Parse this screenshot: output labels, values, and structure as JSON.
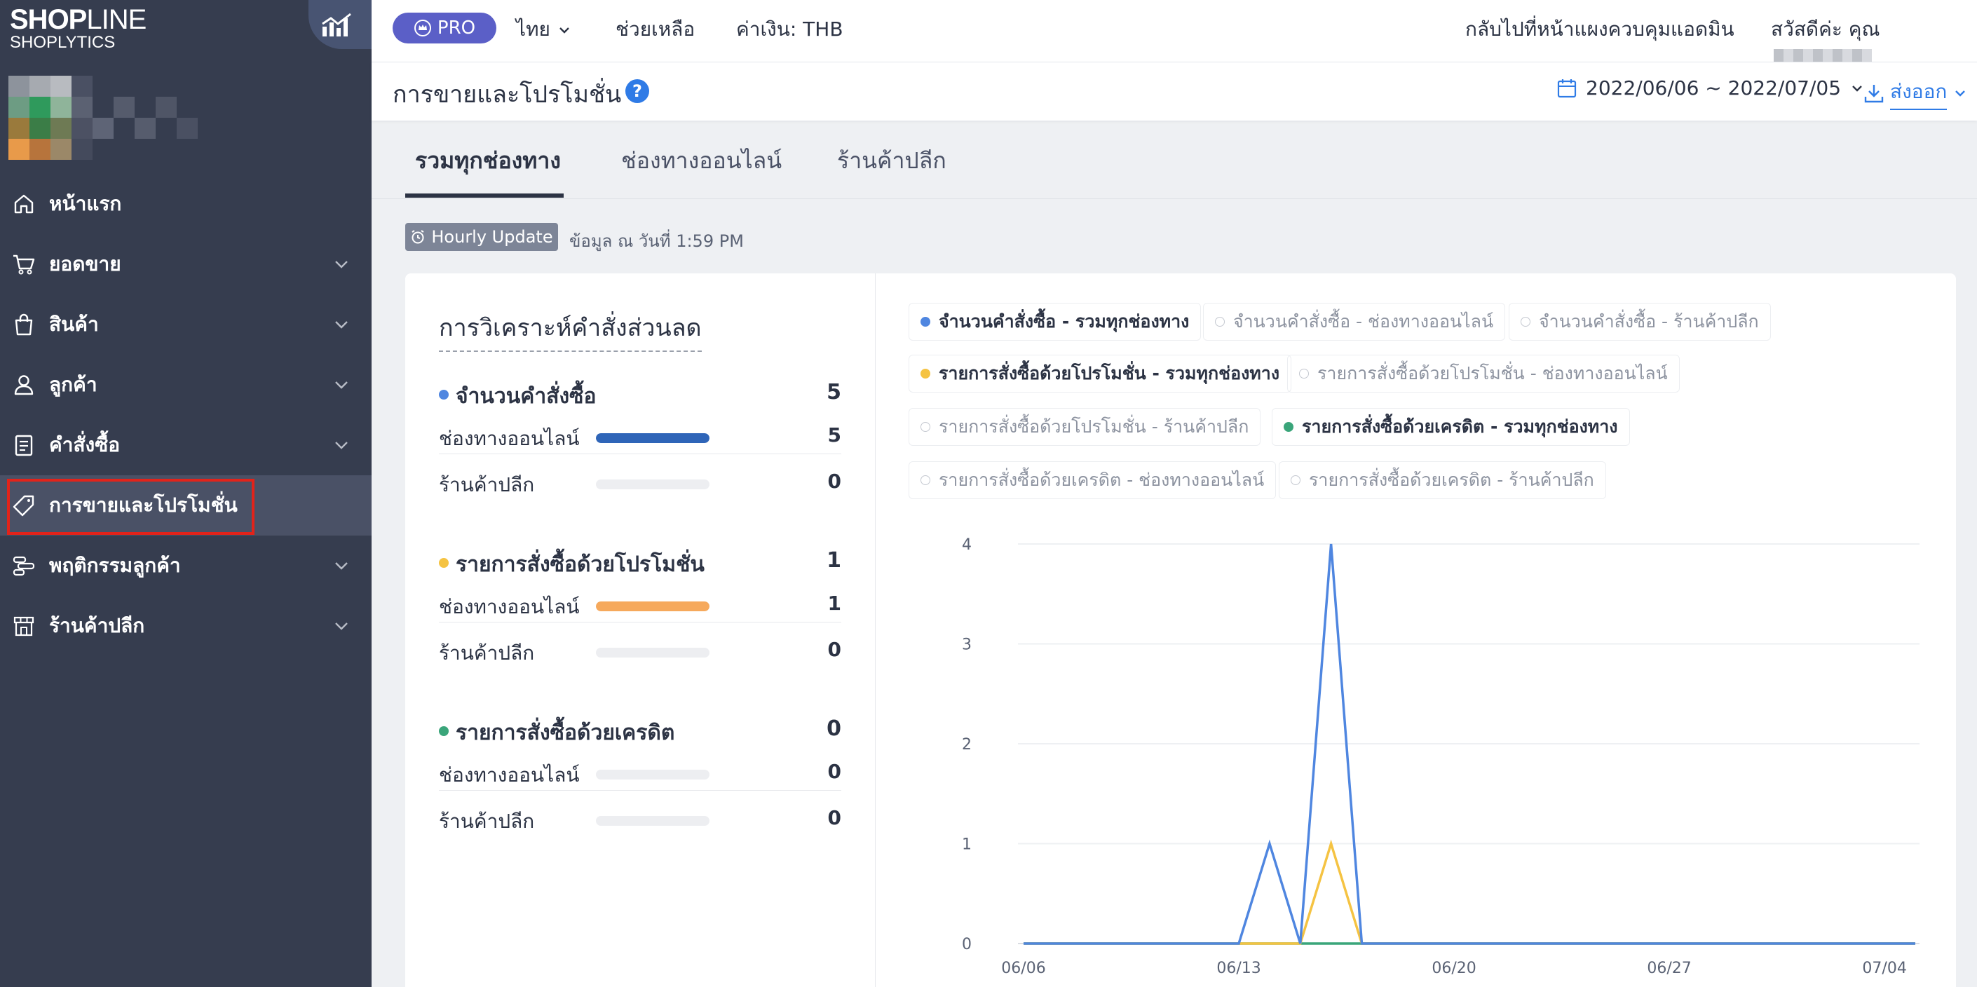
{
  "brand": {
    "logo_main_bold": "SHOP",
    "logo_main_light": "LINE",
    "logo_sub": "SHOPLYTICS"
  },
  "sidebar": {
    "items": [
      {
        "label": "หน้าแรก",
        "icon": "home-icon",
        "expandable": false
      },
      {
        "label": "ยอดขาย",
        "icon": "cart-icon",
        "expandable": true
      },
      {
        "label": "สินค้า",
        "icon": "bag-icon",
        "expandable": true
      },
      {
        "label": "ลูกค้า",
        "icon": "user-icon",
        "expandable": true
      },
      {
        "label": "คำสั่งซื้อ",
        "icon": "clipboard-icon",
        "expandable": true
      },
      {
        "label": "การขายและโปรโมชั่น",
        "icon": "tag-icon",
        "expandable": false,
        "active": true
      },
      {
        "label": "พฤติกรรมลูกค้า",
        "icon": "behavior-icon",
        "expandable": true
      },
      {
        "label": "ร้านค้าปลีก",
        "icon": "store-icon",
        "expandable": true
      }
    ]
  },
  "topbar": {
    "pro": "PRO",
    "language": "ไทย",
    "help": "ช่วยเหลือ",
    "currency": "ค่าเงิน: THB",
    "back_admin": "กลับไปที่หน้าแผงควบคุมแอดมิน",
    "greeting": "สวัสดีค่ะ คุณ"
  },
  "header": {
    "title": "การขายและโปรโมชั่น",
    "date_range": "2022/06/06 ~ 2022/07/05",
    "export": "ส่งออก"
  },
  "tabs": [
    {
      "label": "รวมทุกช่องทาง",
      "active": true
    },
    {
      "label": "ช่องทางออนไลน์",
      "active": false
    },
    {
      "label": "ร้านค้าปลีก",
      "active": false
    }
  ],
  "update": {
    "badge": "Hourly Update",
    "text": "ข้อมูล ณ วันที่ 1:59 PM"
  },
  "analysis": {
    "title": "การวิเคราะห์คำสั่งส่วนลด",
    "groups": [
      {
        "name": "จำนวนคำสั่งซื้อ",
        "value": "5",
        "color": "#4f86e0",
        "rows": [
          {
            "label": "ช่องทางออนไลน์",
            "value": "5",
            "fill": 1.0,
            "color": "#2f65b8"
          },
          {
            "label": "ร้านค้าปลีก",
            "value": "0",
            "fill": 0,
            "color": "#2f65b8"
          }
        ]
      },
      {
        "name": "รายการสั่งซื้อด้วยโปรโมชั่น",
        "value": "1",
        "color": "#f5c342",
        "rows": [
          {
            "label": "ช่องทางออนไลน์",
            "value": "1",
            "fill": 1.0,
            "color": "#f6a95c"
          },
          {
            "label": "ร้านค้าปลีก",
            "value": "0",
            "fill": 0,
            "color": "#f6a95c"
          }
        ]
      },
      {
        "name": "รายการสั่งซื้อด้วยเครดิต",
        "value": "0",
        "color": "#3aa57a",
        "rows": [
          {
            "label": "ช่องทางออนไลน์",
            "value": "0",
            "fill": 0,
            "color": "#3aa57a"
          },
          {
            "label": "ร้านค้าปลีก",
            "value": "0",
            "fill": 0,
            "color": "#3aa57a"
          }
        ]
      }
    ]
  },
  "legend": [
    {
      "label": "จำนวนคำสั่งซื้อ - รวมทุกช่องทาง",
      "on": true,
      "color": "#4f86e0"
    },
    {
      "label": "จำนวนคำสั่งซื้อ - ช่องทางออนไลน์",
      "on": false
    },
    {
      "label": "จำนวนคำสั่งซื้อ - ร้านค้าปลีก",
      "on": false
    },
    {
      "label": "รายการสั่งซื้อด้วยโปรโมชั่น - รวมทุกช่องทาง",
      "on": true,
      "color": "#f5c342"
    },
    {
      "label": "รายการสั่งซื้อด้วยโปรโมชั่น - ช่องทางออนไลน์",
      "on": false
    },
    {
      "label": "รายการสั่งซื้อด้วยโปรโมชั่น - ร้านค้าปลีก",
      "on": false
    },
    {
      "label": "รายการสั่งซื้อด้วยเครดิต - รวมทุกช่องทาง",
      "on": true,
      "color": "#3aa57a"
    },
    {
      "label": "รายการสั่งซื้อด้วยเครดิต - ช่องทางออนไลน์",
      "on": false
    },
    {
      "label": "รายการสั่งซื้อด้วยเครดิต - ร้านค้าปลีก",
      "on": false
    }
  ],
  "chart_data": {
    "type": "line",
    "x": [
      "06/06",
      "06/07",
      "06/08",
      "06/09",
      "06/10",
      "06/11",
      "06/12",
      "06/13",
      "06/14",
      "06/15",
      "06/16",
      "06/17",
      "06/18",
      "06/19",
      "06/20",
      "06/21",
      "06/22",
      "06/23",
      "06/24",
      "06/25",
      "06/26",
      "06/27",
      "06/28",
      "06/29",
      "06/30",
      "07/01",
      "07/02",
      "07/03",
      "07/04",
      "07/05"
    ],
    "x_tick_labels": [
      "06/06",
      "06/13",
      "06/20",
      "06/27",
      "07/04"
    ],
    "ylim": [
      0,
      4
    ],
    "y_ticks": [
      "0",
      "1",
      "2",
      "3",
      "4"
    ],
    "grid": true,
    "series": [
      {
        "name": "จำนวนคำสั่งซื้อ - รวมทุกช่องทาง",
        "color": "#4f86e0",
        "values": [
          0,
          0,
          0,
          0,
          0,
          0,
          0,
          0,
          1,
          0,
          4,
          0,
          0,
          0,
          0,
          0,
          0,
          0,
          0,
          0,
          0,
          0,
          0,
          0,
          0,
          0,
          0,
          0,
          0,
          0
        ]
      },
      {
        "name": "รายการสั่งซื้อด้วยโปรโมชั่น - รวมทุกช่องทาง",
        "color": "#f5c342",
        "values": [
          0,
          0,
          0,
          0,
          0,
          0,
          0,
          0,
          0,
          0,
          1,
          0,
          0,
          0,
          0,
          0,
          0,
          0,
          0,
          0,
          0,
          0,
          0,
          0,
          0,
          0,
          0,
          0,
          0,
          0
        ]
      },
      {
        "name": "รายการสั่งซื้อด้วยเครดิต - รวมทุกช่องทาง",
        "color": "#3aa57a",
        "values": [
          0,
          0,
          0,
          0,
          0,
          0,
          0,
          0,
          0,
          0,
          0,
          0,
          0,
          0,
          0,
          0,
          0,
          0,
          0,
          0,
          0,
          0,
          0,
          0,
          0,
          0,
          0,
          0,
          0,
          0
        ]
      }
    ]
  }
}
